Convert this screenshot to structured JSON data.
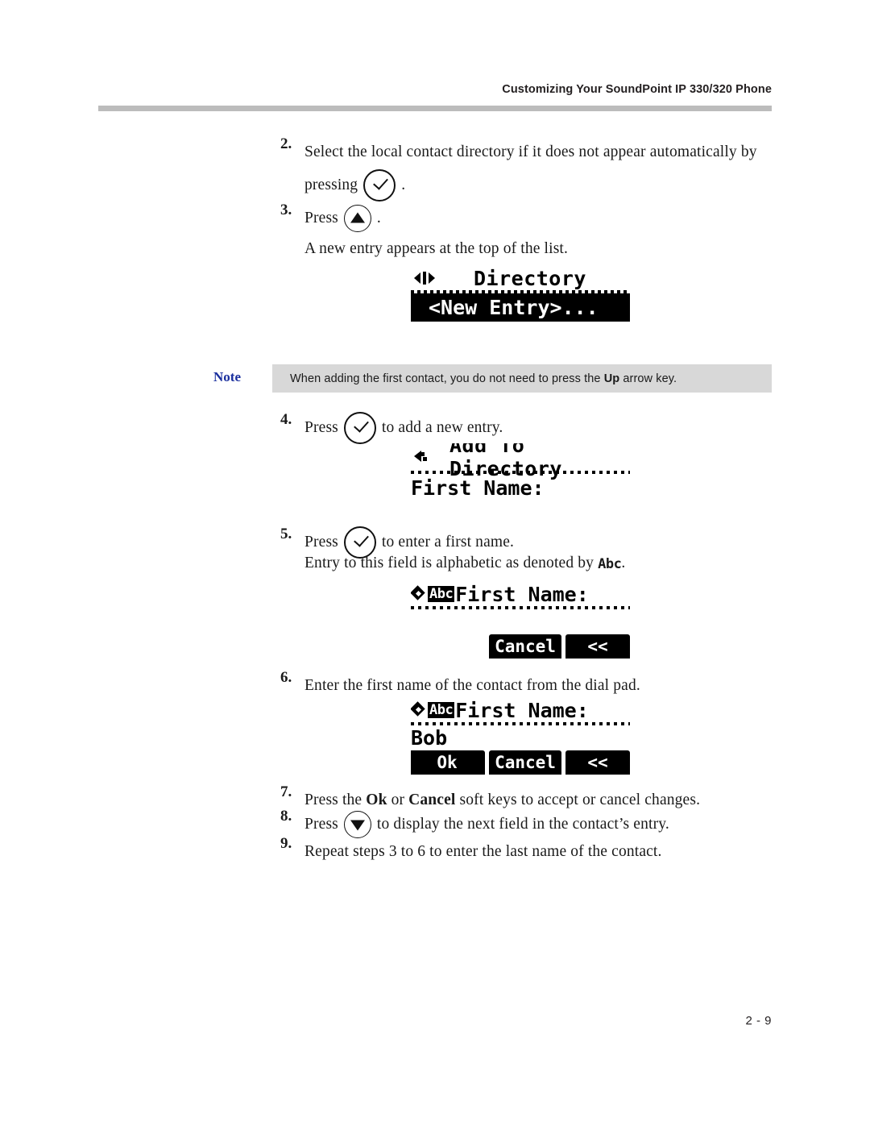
{
  "header": {
    "title": "Customizing Your SoundPoint IP 330/320 Phone"
  },
  "footer": {
    "page_number": "2 - 9"
  },
  "steps": [
    {
      "num": "2.",
      "text_before": "Select the local contact directory if it does not appear automatically by",
      "text_second_line_before": "pressing",
      "icon": "checkmark-key-icon",
      "text_after": "."
    },
    {
      "num": "3.",
      "text_before": "Press",
      "icon": "up-arrow-key-icon",
      "text_after": "."
    },
    {
      "num": "4.",
      "text_before": "Press",
      "icon": "checkmark-key-icon",
      "text_after": "to add a new entry."
    },
    {
      "num": "5.",
      "text_before": "Press",
      "icon": "checkmark-key-icon",
      "text_after": "to enter a first name.",
      "sub_before": "Entry to this field is alphabetic as denoted by",
      "sub_badge": "Abc",
      "sub_after": "."
    },
    {
      "num": "6.",
      "text_before": "Enter the first name of the contact from the dial pad."
    },
    {
      "num": "7.",
      "text_before": "Press the ",
      "bold_1": "Ok",
      "mid_1": " or ",
      "bold_2": "Cancel",
      "text_after": " soft keys to accept or cancel changes."
    },
    {
      "num": "8.",
      "text_before": "Press",
      "icon": "down-arrow-key-icon",
      "text_after": "to display the next field in the contact’s entry."
    },
    {
      "num": "9.",
      "text_before": "Repeat steps 3 to 6 to enter the last name of the contact."
    }
  ],
  "result_line_3": "A new entry appears at the top of the list.",
  "note": {
    "label": "Note",
    "text_before": "When adding the first contact, you do not need to press the ",
    "bold": "Up",
    "text_after": " arrow key."
  },
  "lcd_screens": {
    "directory": {
      "nav_icon": "left-right-arrow-icon",
      "title": "Directory",
      "selected_row": "<New Entry>..."
    },
    "add_to_directory": {
      "nav_icon": "back-arrow-icon",
      "title": "Add To Directory",
      "field_label": "First Name:"
    },
    "first_name_empty": {
      "nav_icon": "diamond-nav-icon",
      "mode_badge": "Abc",
      "field_label": "First Name:",
      "value": "",
      "softkeys": [
        "Cancel",
        "<<"
      ]
    },
    "first_name_bob": {
      "nav_icon": "diamond-nav-icon",
      "mode_badge": "Abc",
      "field_label": "First Name:",
      "value": "Bob",
      "softkeys": [
        "Ok",
        "Cancel",
        "<<"
      ]
    }
  }
}
